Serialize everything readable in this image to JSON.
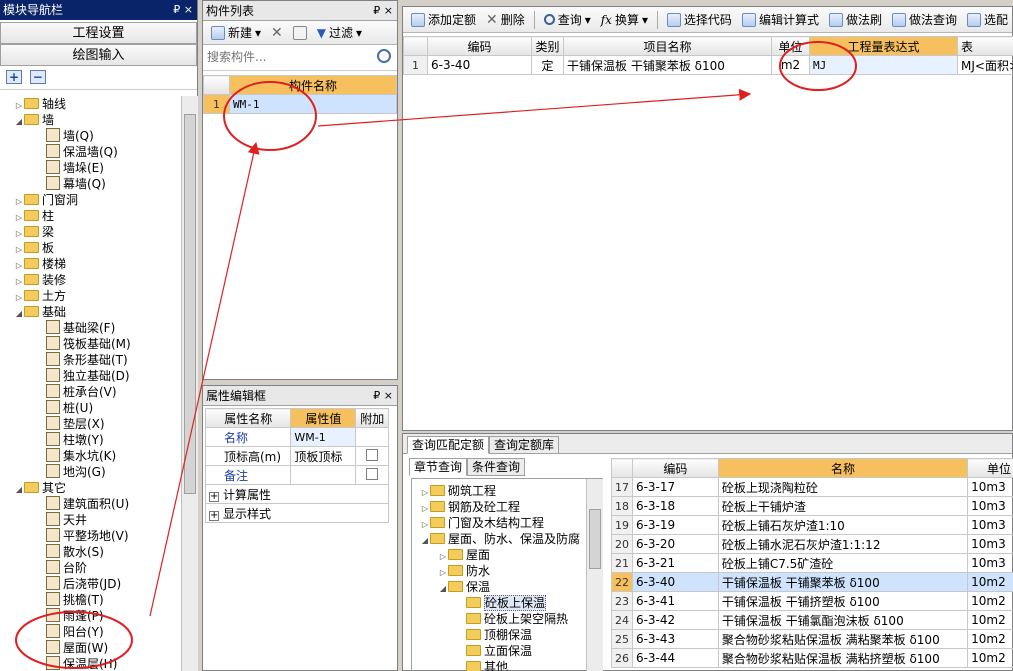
{
  "nav": {
    "title": "模块导航栏",
    "pin": "₽ ×",
    "btn_engineering": "工程设置",
    "btn_drawing": "绘图输入",
    "expand": "+",
    "collapse": "−",
    "tree": [
      {
        "label": "轴线",
        "level": 0,
        "type": "folder",
        "state": "closed"
      },
      {
        "label": "墙",
        "level": 0,
        "type": "folder",
        "state": "open"
      },
      {
        "label": "墙(Q)",
        "level": 1,
        "type": "leaf"
      },
      {
        "label": "保温墙(Q)",
        "level": 1,
        "type": "leaf"
      },
      {
        "label": "墙垛(E)",
        "level": 1,
        "type": "leaf"
      },
      {
        "label": "幕墙(Q)",
        "level": 1,
        "type": "leaf"
      },
      {
        "label": "门窗洞",
        "level": 0,
        "type": "folder",
        "state": "closed"
      },
      {
        "label": "柱",
        "level": 0,
        "type": "folder",
        "state": "closed"
      },
      {
        "label": "梁",
        "level": 0,
        "type": "folder",
        "state": "closed"
      },
      {
        "label": "板",
        "level": 0,
        "type": "folder",
        "state": "closed"
      },
      {
        "label": "楼梯",
        "level": 0,
        "type": "folder",
        "state": "closed"
      },
      {
        "label": "装修",
        "level": 0,
        "type": "folder",
        "state": "closed"
      },
      {
        "label": "土方",
        "level": 0,
        "type": "folder",
        "state": "closed"
      },
      {
        "label": "基础",
        "level": 0,
        "type": "folder",
        "state": "open"
      },
      {
        "label": "基础梁(F)",
        "level": 1,
        "type": "leaf"
      },
      {
        "label": "筏板基础(M)",
        "level": 1,
        "type": "leaf"
      },
      {
        "label": "条形基础(T)",
        "level": 1,
        "type": "leaf"
      },
      {
        "label": "独立基础(D)",
        "level": 1,
        "type": "leaf"
      },
      {
        "label": "桩承台(V)",
        "level": 1,
        "type": "leaf"
      },
      {
        "label": "桩(U)",
        "level": 1,
        "type": "leaf"
      },
      {
        "label": "垫层(X)",
        "level": 1,
        "type": "leaf"
      },
      {
        "label": "柱墩(Y)",
        "level": 1,
        "type": "leaf"
      },
      {
        "label": "集水坑(K)",
        "level": 1,
        "type": "leaf"
      },
      {
        "label": "地沟(G)",
        "level": 1,
        "type": "leaf"
      },
      {
        "label": "其它",
        "level": 0,
        "type": "folder",
        "state": "open"
      },
      {
        "label": "建筑面积(U)",
        "level": 1,
        "type": "leaf"
      },
      {
        "label": "天井",
        "level": 1,
        "type": "leaf"
      },
      {
        "label": "平整场地(V)",
        "level": 1,
        "type": "leaf"
      },
      {
        "label": "散水(S)",
        "level": 1,
        "type": "leaf"
      },
      {
        "label": "台阶",
        "level": 1,
        "type": "leaf"
      },
      {
        "label": "后浇带(JD)",
        "level": 1,
        "type": "leaf"
      },
      {
        "label": "挑檐(T)",
        "level": 1,
        "type": "leaf"
      },
      {
        "label": "雨蓬(P)",
        "level": 1,
        "type": "leaf"
      },
      {
        "label": "阳台(Y)",
        "level": 1,
        "type": "leaf"
      },
      {
        "label": "屋面(W)",
        "level": 1,
        "type": "leaf"
      },
      {
        "label": "保温层(H)",
        "level": 1,
        "type": "leaf"
      }
    ]
  },
  "component_list": {
    "title": "构件列表",
    "pin": "₽ ×",
    "new_label": "新建",
    "filter_label": "过滤",
    "search_placeholder": "搜索构件...",
    "col_name": "构件名称",
    "rows": [
      {
        "num": "1",
        "name": "WM-1"
      }
    ]
  },
  "property_editor": {
    "title": "属性编辑框",
    "pin": "₽ ×",
    "col_name": "属性名称",
    "col_value": "属性值",
    "col_extra": "附加",
    "rows": [
      {
        "name": "名称",
        "value": "WM-1",
        "check": false,
        "link": true
      },
      {
        "name": "顶标高(m)",
        "value": "顶板顶标",
        "check": true,
        "link": false
      },
      {
        "name": "备注",
        "value": "",
        "check": true,
        "link": true
      },
      {
        "name": "计算属性",
        "value": "",
        "check": false,
        "group": true
      },
      {
        "name": "显示样式",
        "value": "",
        "check": false,
        "group": true
      }
    ]
  },
  "toolbar": {
    "add_quota": "添加定额",
    "delete": "删除",
    "query": "查询",
    "convert": "换算",
    "select_code": "选择代码",
    "edit_formula": "编辑计算式",
    "method_brush": "做法刷",
    "method_query": "做法查询",
    "select_match": "选配"
  },
  "quota_grid": {
    "headers": [
      "编码",
      "类别",
      "项目名称",
      "单位",
      "工程量表达式",
      "表"
    ],
    "rows": [
      {
        "num": "1",
        "code": "6-3-40",
        "kind": "定",
        "name": "干铺保温板 干铺聚苯板 δ100",
        "unit": "m2",
        "expr": "MJ",
        "expr2": "MJ<面积>"
      }
    ]
  },
  "query": {
    "tab1": "查询匹配定额",
    "tab2": "查询定额库",
    "subtab1": "章节查询",
    "subtab2": "条件查询",
    "chapter_tree": [
      {
        "label": "砌筑工程",
        "level": 0,
        "state": "closed"
      },
      {
        "label": "钢筋及砼工程",
        "level": 0,
        "state": "closed"
      },
      {
        "label": "门窗及木结构工程",
        "level": 0,
        "state": "closed"
      },
      {
        "label": "屋面、防水、保温及防腐",
        "level": 0,
        "state": "open"
      },
      {
        "label": "屋面",
        "level": 1,
        "state": "closed"
      },
      {
        "label": "防水",
        "level": 1,
        "state": "closed"
      },
      {
        "label": "保温",
        "level": 1,
        "state": "open"
      },
      {
        "label": "砼板上保温",
        "level": 2,
        "state": "leaf",
        "selected": true
      },
      {
        "label": "砼板上架空隔热",
        "level": 2,
        "state": "leaf"
      },
      {
        "label": "顶棚保温",
        "level": 2,
        "state": "leaf"
      },
      {
        "label": "立面保温",
        "level": 2,
        "state": "leaf"
      },
      {
        "label": "其他",
        "level": 2,
        "state": "leaf"
      }
    ],
    "result_headers": [
      "编码",
      "名称",
      "单位"
    ],
    "results": [
      {
        "num": "17",
        "code": "6-3-17",
        "name": "砼板上现浇陶粒砼",
        "unit": "10m3"
      },
      {
        "num": "18",
        "code": "6-3-18",
        "name": "砼板上干铺炉渣",
        "unit": "10m3"
      },
      {
        "num": "19",
        "code": "6-3-19",
        "name": "砼板上铺石灰炉渣1:10",
        "unit": "10m3"
      },
      {
        "num": "20",
        "code": "6-3-20",
        "name": "砼板上铺水泥石灰炉渣1:1:12",
        "unit": "10m3"
      },
      {
        "num": "21",
        "code": "6-3-21",
        "name": "砼板上铺C7.5矿渣砼",
        "unit": "10m3"
      },
      {
        "num": "22",
        "code": "6-3-40",
        "name": "干铺保温板 干铺聚苯板 δ100",
        "unit": "10m2",
        "selected": true
      },
      {
        "num": "23",
        "code": "6-3-41",
        "name": "干铺保温板 干铺挤塑板 δ100",
        "unit": "10m2"
      },
      {
        "num": "24",
        "code": "6-3-42",
        "name": "干铺保温板 干铺氯酯泡沫板 δ100",
        "unit": "10m2"
      },
      {
        "num": "25",
        "code": "6-3-43",
        "name": "聚合物砂浆粘贴保温板 满粘聚苯板 δ100",
        "unit": "10m2"
      },
      {
        "num": "26",
        "code": "6-3-44",
        "name": "聚合物砂浆粘贴保温板 满粘挤塑板 δ100",
        "unit": "10m2"
      }
    ]
  },
  "colors": {
    "annotation": "#e02020",
    "header_orange": "#f6c05f",
    "selection": "#cfe3ff"
  }
}
